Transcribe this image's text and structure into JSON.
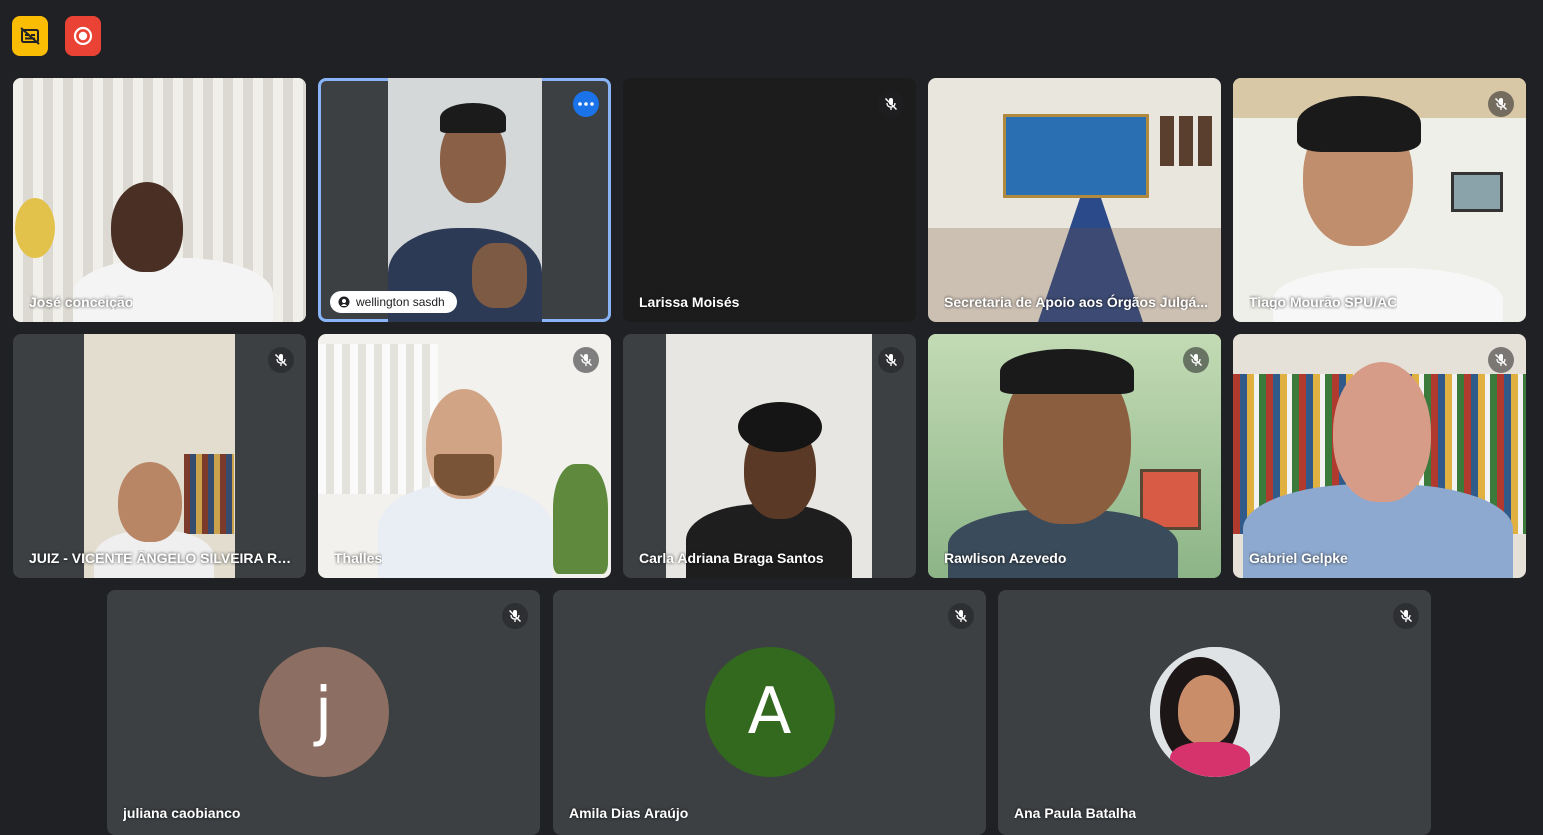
{
  "top_controls": {
    "captions_icon": "captions-off-icon",
    "record_icon": "recording-icon",
    "captions_color": "#fbbc04",
    "record_color": "#ea4335"
  },
  "participants": [
    {
      "name": "José conceição",
      "muted": false
    },
    {
      "name": "wellington sasdh",
      "muted": false,
      "speaking": true
    },
    {
      "name": "Larissa Moisés",
      "muted": true
    },
    {
      "name": "Secretaria de Apoio aos Órgãos Julgá...",
      "muted": false
    },
    {
      "name": "Tiago Mourão SPU/AC",
      "muted": true
    },
    {
      "name": "JUIZ - VICENTE ÂNGELO SILVEIRA RE...",
      "muted": true
    },
    {
      "name": "Thalles",
      "muted": true
    },
    {
      "name": "Carla Adriana Braga Santos",
      "muted": true
    },
    {
      "name": "Rawlison Azevedo",
      "muted": true
    },
    {
      "name": "Gabriel Gelpke",
      "muted": true
    },
    {
      "name": "juliana caobianco",
      "muted": true,
      "avatar_letter": "j",
      "avatar_color": "#8d6e63"
    },
    {
      "name": "Amila Dias Araújo",
      "muted": true,
      "avatar_letter": "A",
      "avatar_color": "#33691e"
    },
    {
      "name": "Ana Paula Batalha",
      "muted": true
    }
  ],
  "colors": {
    "background": "#202124",
    "tile": "#3c4043",
    "speaking_outline": "#8ab4f8",
    "more_button": "#1a73e8"
  }
}
